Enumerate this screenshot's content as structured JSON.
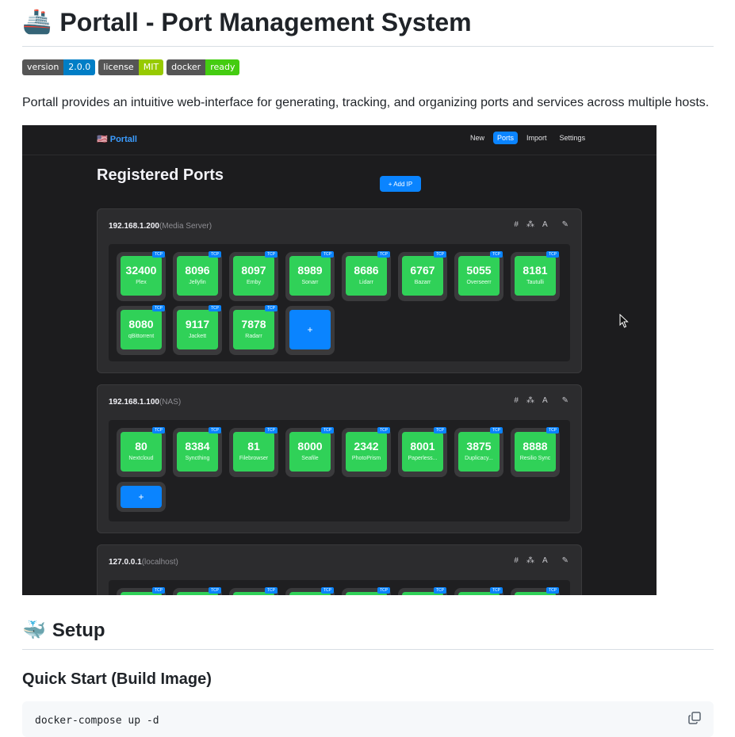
{
  "title": {
    "emoji": "🚢",
    "text": "Portall - Port Management System"
  },
  "badges": [
    {
      "label": "version",
      "value": "2.0.0",
      "color": "#007ec6"
    },
    {
      "label": "license",
      "value": "MIT",
      "color": "#97ca00"
    },
    {
      "label": "docker",
      "value": "ready",
      "color": "#4c1"
    }
  ],
  "description": "Portall provides an intuitive web-interface for generating, tracking, and organizing ports and services across multiple hosts.",
  "screenshot": {
    "brand": "🇺🇸 Portall",
    "nav": [
      "New",
      "Ports",
      "Import",
      "Settings"
    ],
    "active_nav": "Ports",
    "heading": "Registered Ports",
    "add_ip": "+ Add IP",
    "tools": [
      "#",
      "⁂",
      "A",
      "✎"
    ],
    "hosts": [
      {
        "ip": "192.168.1.200",
        "name": "(Media Server)",
        "ports": [
          {
            "port": "32400",
            "service": "Plex",
            "proto": "TCP"
          },
          {
            "port": "8096",
            "service": "Jellyfin",
            "proto": "TCP"
          },
          {
            "port": "8097",
            "service": "Emby",
            "proto": "TCP"
          },
          {
            "port": "8989",
            "service": "Sonarr",
            "proto": "TCP"
          },
          {
            "port": "8686",
            "service": "Lidarr",
            "proto": "TCP"
          },
          {
            "port": "6767",
            "service": "Bazarr",
            "proto": "TCP"
          },
          {
            "port": "5055",
            "service": "Overseerr",
            "proto": "TCP"
          },
          {
            "port": "8181",
            "service": "Tautulli",
            "proto": "TCP"
          },
          {
            "port": "8080",
            "service": "qBittorrent",
            "proto": "TCP"
          },
          {
            "port": "9117",
            "service": "Jackett",
            "proto": "TCP"
          },
          {
            "port": "7878",
            "service": "Radarr",
            "proto": "TCP"
          }
        ]
      },
      {
        "ip": "192.168.1.100",
        "name": "(NAS)",
        "ports": [
          {
            "port": "80",
            "service": "Nextcloud",
            "proto": "TCP"
          },
          {
            "port": "8384",
            "service": "Syncthing",
            "proto": "TCP"
          },
          {
            "port": "81",
            "service": "Filebrowser",
            "proto": "TCP"
          },
          {
            "port": "8000",
            "service": "Seafile",
            "proto": "TCP"
          },
          {
            "port": "2342",
            "service": "PhotoPrism",
            "proto": "TCP"
          },
          {
            "port": "8001",
            "service": "Paperless...",
            "proto": "TCP"
          },
          {
            "port": "3875",
            "service": "Duplicacy...",
            "proto": "TCP"
          },
          {
            "port": "8888",
            "service": "Resilio Sync",
            "proto": "TCP"
          }
        ]
      },
      {
        "ip": "127.0.0.1",
        "name": "(localhost)",
        "ports": []
      }
    ],
    "add_port": "+",
    "peek_proto": "TCP"
  },
  "setup": {
    "emoji": "🐳",
    "text": "Setup"
  },
  "quick_start": "Quick Start (Build Image)",
  "code": "docker-compose up -d"
}
